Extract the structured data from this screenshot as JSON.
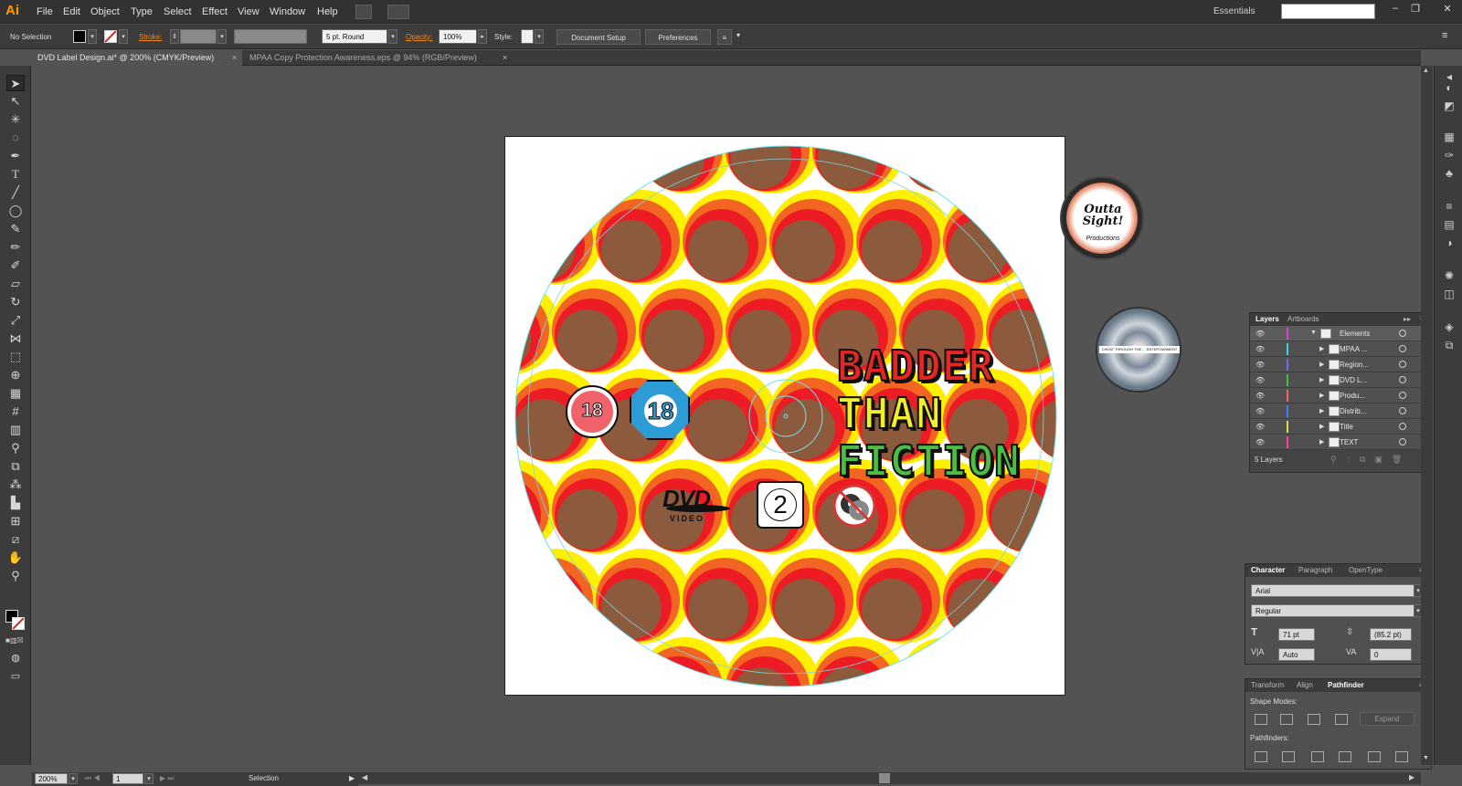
{
  "app": {
    "logo": "Ai"
  },
  "menu": [
    "File",
    "Edit",
    "Object",
    "Type",
    "Select",
    "Effect",
    "View",
    "Window",
    "Help"
  ],
  "workspace": {
    "label": "Essentials"
  },
  "control": {
    "selection": "No Selection",
    "stroke_label": "Stroke:",
    "brush": "5 pt. Round",
    "opacity_label": "Opacity:",
    "opacity": "100%",
    "style_label": "Style:",
    "doc_setup": "Document Setup",
    "preferences": "Preferences"
  },
  "tabs": [
    {
      "label": "DVD Label Design.ai* @ 200% (CMYK/Preview)",
      "active": true
    },
    {
      "label": "MPAA Copy Protection Awareness.eps @ 94% (RGB/Preview)",
      "active": false
    }
  ],
  "status": {
    "zoom": "200%",
    "page": "1",
    "tool": "Selection"
  },
  "art": {
    "title_lines": [
      "BADDER",
      "THAN",
      "FICTION"
    ],
    "rating_a": "18",
    "rating_b": "18",
    "region": "2",
    "dvd": "DVD",
    "video": "VIDEO",
    "logo_text": "Outta Sight!",
    "logo_sub": "Productions",
    "distrib_text": "CHEAT THROUGH THE ... ENTERTAINMENT"
  },
  "layers_panel": {
    "tabs": [
      "Layers",
      "Artboards"
    ],
    "rows": [
      {
        "name": "Elements",
        "color": "#e040e0"
      },
      {
        "name": "MPAA ...",
        "color": "#40d0e0"
      },
      {
        "name": "Region...",
        "color": "#6a6aff"
      },
      {
        "name": "DVD L...",
        "color": "#40c040"
      },
      {
        "name": "Produ...",
        "color": "#ff6060"
      },
      {
        "name": "Distrib...",
        "color": "#4080ff"
      },
      {
        "name": "Title",
        "color": "#e0e040"
      },
      {
        "name": "TEXT",
        "color": "#ff40a0"
      }
    ],
    "footer": "5 Layers"
  },
  "character_panel": {
    "tabs": [
      "Character",
      "Paragraph",
      "OpenType"
    ],
    "font": "Arial",
    "style": "Regular",
    "size": "71 pt",
    "leading": "(85.2 pt)",
    "kerning": "Auto",
    "tracking": "0"
  },
  "pathfinder_panel": {
    "tabs": [
      "Transform",
      "Align",
      "Pathfinder"
    ],
    "shape_modes": "Shape Modes:",
    "pathfinders": "Pathfinders:",
    "expand": "Expand"
  }
}
